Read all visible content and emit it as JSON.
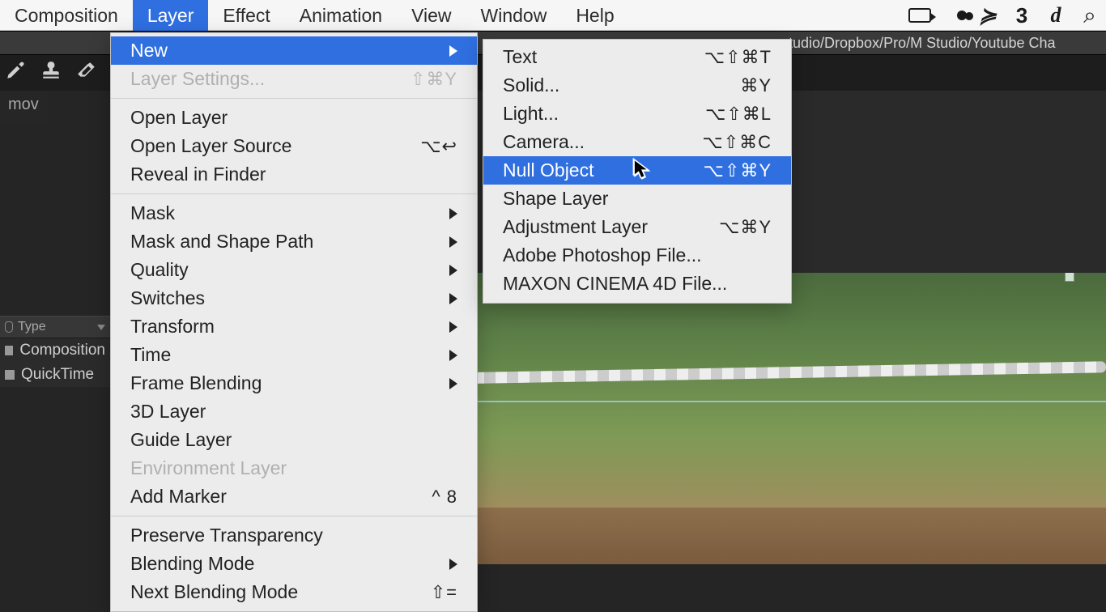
{
  "menubar": {
    "items": [
      "Composition",
      "Layer",
      "Effect",
      "Animation",
      "View",
      "Window",
      "Help"
    ],
    "active_index": 1
  },
  "right_icons": [
    "camera",
    "cloud",
    "swirl",
    "ae-3",
    "d-italic",
    "search"
  ],
  "titlebar": {
    "path_fragment": "tudio/Dropbox/Pro/M Studio/Youtube Cha"
  },
  "toolbar": {
    "tools": [
      "brush",
      "stamp",
      "eraser"
    ]
  },
  "panel_header": {
    "label": "mov"
  },
  "project_panel": {
    "column_label": "Type",
    "rows": [
      "Composition",
      "QuickTime"
    ]
  },
  "layer_menu": {
    "items": [
      {
        "label": "New",
        "shortcut": "",
        "type": "submenu",
        "highlight": true
      },
      {
        "label": "Layer Settings...",
        "shortcut": "⇧⌘Y",
        "type": "item",
        "disabled": true
      },
      {
        "type": "sep"
      },
      {
        "label": "Open Layer",
        "shortcut": "",
        "type": "item"
      },
      {
        "label": "Open Layer Source",
        "shortcut": "⌥↩",
        "type": "item"
      },
      {
        "label": "Reveal in Finder",
        "shortcut": "",
        "type": "item"
      },
      {
        "type": "sep"
      },
      {
        "label": "Mask",
        "shortcut": "",
        "type": "submenu"
      },
      {
        "label": "Mask and Shape Path",
        "shortcut": "",
        "type": "submenu"
      },
      {
        "label": "Quality",
        "shortcut": "",
        "type": "submenu"
      },
      {
        "label": "Switches",
        "shortcut": "",
        "type": "submenu"
      },
      {
        "label": "Transform",
        "shortcut": "",
        "type": "submenu"
      },
      {
        "label": "Time",
        "shortcut": "",
        "type": "submenu"
      },
      {
        "label": "Frame Blending",
        "shortcut": "",
        "type": "submenu"
      },
      {
        "label": "3D Layer",
        "shortcut": "",
        "type": "item"
      },
      {
        "label": "Guide Layer",
        "shortcut": "",
        "type": "item"
      },
      {
        "label": "Environment Layer",
        "shortcut": "",
        "type": "item",
        "disabled": true
      },
      {
        "label": "Add Marker",
        "shortcut": "^ 8",
        "type": "item"
      },
      {
        "type": "sep"
      },
      {
        "label": "Preserve Transparency",
        "shortcut": "",
        "type": "item"
      },
      {
        "label": "Blending Mode",
        "shortcut": "",
        "type": "submenu"
      },
      {
        "label": "Next Blending Mode",
        "shortcut": "⇧=",
        "type": "item"
      }
    ]
  },
  "new_submenu": {
    "items": [
      {
        "label": "Text",
        "shortcut": "⌥⇧⌘T"
      },
      {
        "label": "Solid...",
        "shortcut": "⌘Y"
      },
      {
        "label": "Light...",
        "shortcut": "⌥⇧⌘L"
      },
      {
        "label": "Camera...",
        "shortcut": "⌥⇧⌘C"
      },
      {
        "label": "Null Object",
        "shortcut": "⌥⇧⌘Y",
        "highlight": true
      },
      {
        "label": "Shape Layer",
        "shortcut": ""
      },
      {
        "label": "Adjustment Layer",
        "shortcut": "⌥⌘Y"
      },
      {
        "label": "Adobe Photoshop File...",
        "shortcut": ""
      },
      {
        "label": "MAXON CINEMA 4D File...",
        "shortcut": ""
      }
    ]
  }
}
